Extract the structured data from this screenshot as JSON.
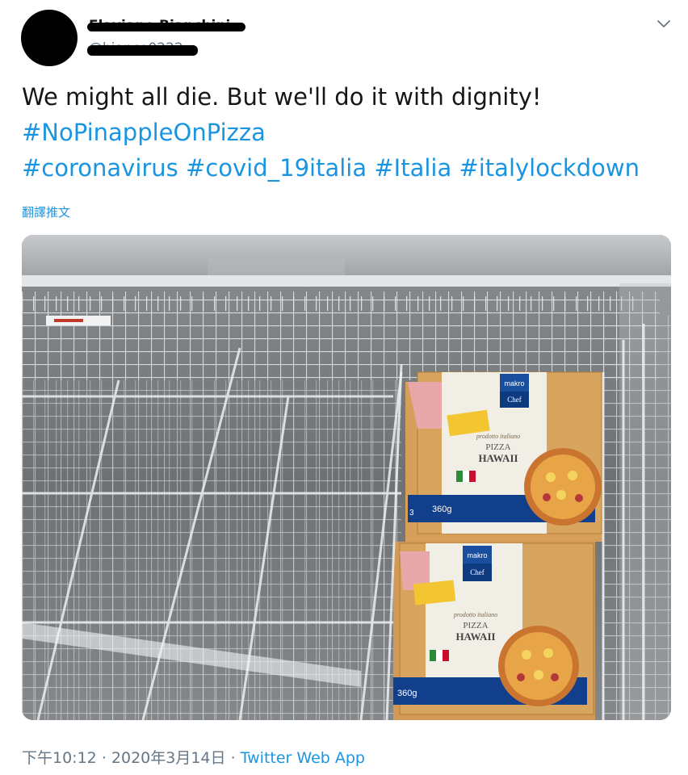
{
  "author": {
    "display_name": "Flaviano Bianchini",
    "handle": "@bianco0222"
  },
  "tweet": {
    "text_line1": "We might all die. But we'll do it with dignity!",
    "hashtag_line2": [
      "#NoPinappleOnPizza"
    ],
    "hashtag_line3": [
      "#coronavirus",
      "#covid_19italia",
      "#Italia",
      "#italylockdown"
    ],
    "translate_label": "翻譯推文"
  },
  "media": {
    "box_brand": "makro",
    "box_sub_brand": "Chef",
    "box_tagline": "prodotto italiano",
    "box_product_line1": "PIZZA",
    "box_product_line2": "HAWAII",
    "box_weight": "360g",
    "box_weight_partial": "3"
  },
  "meta": {
    "time": "下午10:12",
    "separator": "·",
    "date": "2020年3月14日",
    "source": "Twitter Web App"
  },
  "icons": {
    "more": "chevron-down-icon"
  }
}
